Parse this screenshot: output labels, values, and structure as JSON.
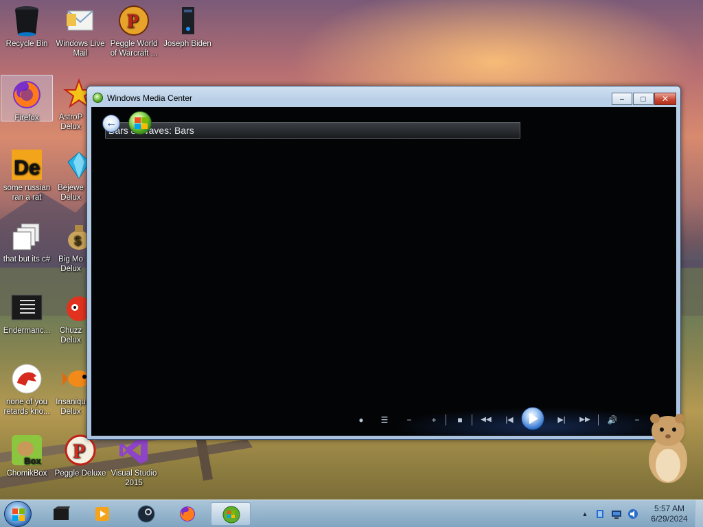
{
  "desktop": {
    "icons": [
      {
        "label": "Recycle Bin",
        "icon": "recycle-bin-icon"
      },
      {
        "label": "Windows Live\nMail",
        "icon": "mail-icon"
      },
      {
        "label": "Peggle World\nof Warcraft ...",
        "icon": "peggle-icon"
      },
      {
        "label": "Joseph Biden",
        "icon": "computer-tower-icon"
      },
      {
        "label": "Firefox",
        "icon": "firefox-icon"
      },
      {
        "label": "AstroP\nDelux",
        "icon": "astropop-icon"
      },
      {
        "label": "some russian\nran a rat",
        "icon": "de-icon"
      },
      {
        "label": "Bejewe\nDelux",
        "icon": "gem-icon"
      },
      {
        "label": "that but its c#",
        "icon": "window-stack-icon"
      },
      {
        "label": "Big Mo\nDelux",
        "icon": "money-bag-icon"
      },
      {
        "label": "Endermanc...",
        "icon": "document-icon"
      },
      {
        "label": "Chuzz\nDelux",
        "icon": "chuzzle-icon"
      },
      {
        "label": "none of you\nretards kno...",
        "icon": "dinosaur-icon"
      },
      {
        "label": "Insaniqu\nDelux",
        "icon": "fish-icon"
      },
      {
        "label": "ChomikBox",
        "icon": "hamster-icon"
      },
      {
        "label": "Peggle Deluxe",
        "icon": "peggle-icon"
      },
      {
        "label": "Visual Studio\n2015",
        "icon": "visual-studio-icon"
      }
    ]
  },
  "window": {
    "title": "Windows Media Center",
    "breadcrumb": "Bars & Waves: Bars",
    "controls": {
      "minimize": "–",
      "maximize": "□",
      "close": "✕"
    }
  },
  "transport": {
    "buttons": [
      "record",
      "guide",
      "channel-down",
      "channel-up",
      "stop",
      "rewind",
      "previous",
      "play",
      "next",
      "fast-forward",
      "volume",
      "volume-down",
      "volume-up"
    ],
    "glyphs": {
      "record": "●",
      "guide": "☰",
      "channel_down": "−",
      "channel_up": "+",
      "stop": "■",
      "rewind": "◀◀",
      "previous": "|◀",
      "next": "▶|",
      "fast_forward": "▶▶",
      "volume": "🔊",
      "volume_down": "−",
      "volume_up": "+"
    }
  },
  "taskbar": {
    "items": [
      "start",
      "folder",
      "media-player",
      "steam",
      "firefox",
      "media-center"
    ],
    "active": "media-center",
    "clock": {
      "time": "5:57 AM",
      "date": "6/29/2024"
    },
    "tray": {
      "expand": "▲"
    }
  },
  "colors": {
    "wmc_background": "#030405",
    "taskbar": "#9fbfdc",
    "accent": "#2a6cc9"
  }
}
